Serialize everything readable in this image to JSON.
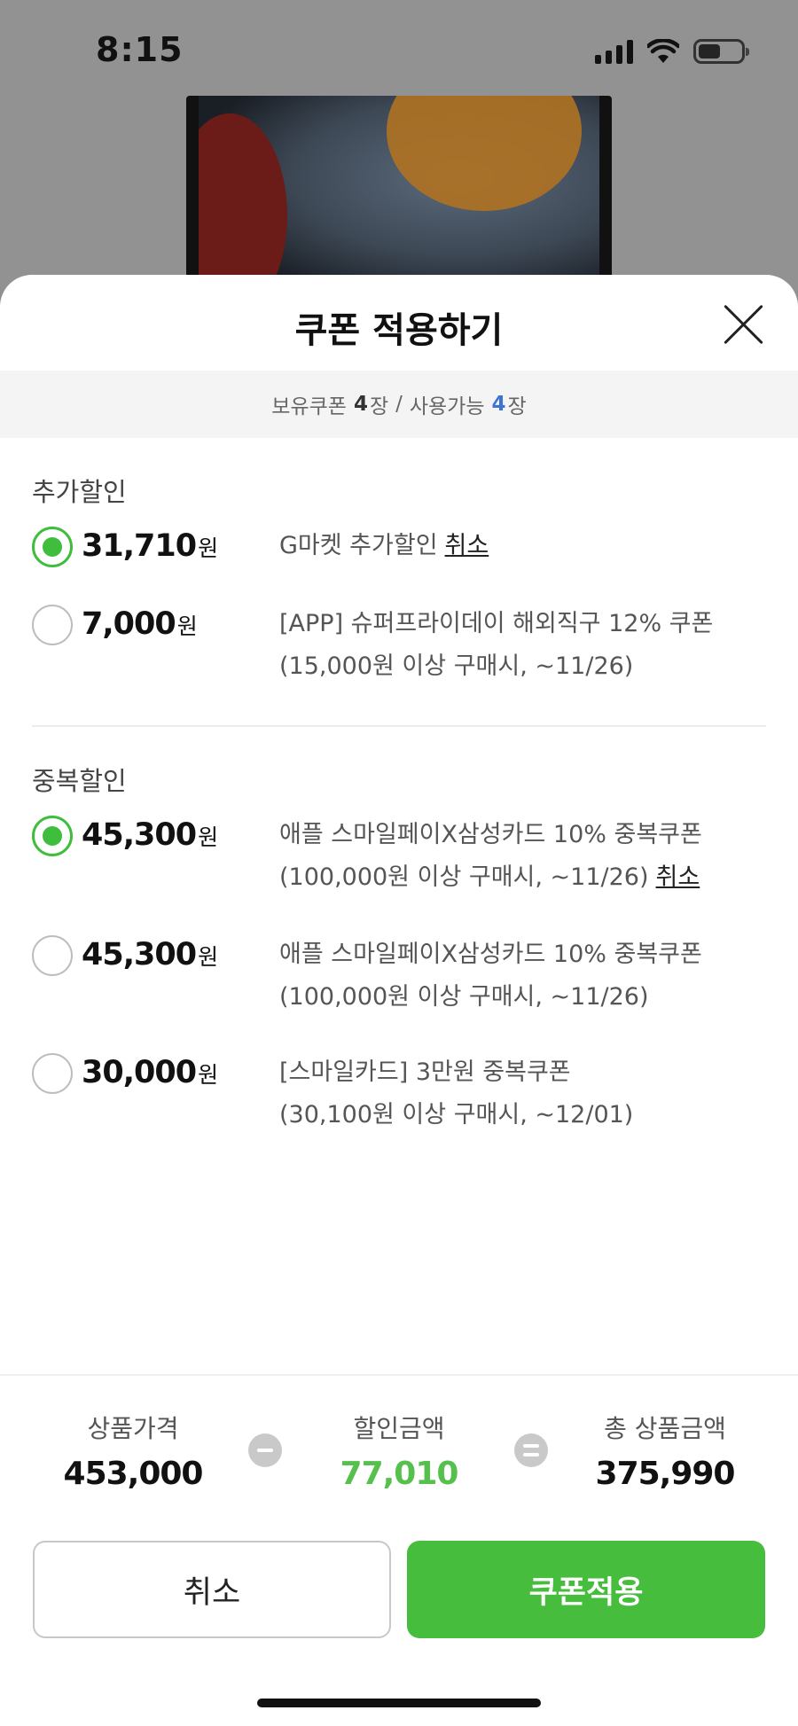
{
  "status_bar": {
    "time": "8:15"
  },
  "sheet": {
    "title": "쿠폰 적용하기",
    "coupon_count": {
      "owned_label": "보유쿠폰",
      "owned_count": "4",
      "owned_unit": "장",
      "separator": "/",
      "usable_label": "사용가능",
      "usable_count": "4",
      "usable_unit": "장"
    }
  },
  "sections": {
    "extra": {
      "title": "추가할인",
      "items": [
        {
          "amount": "31,710",
          "unit": "원",
          "checked": true,
          "line1": "G마켓 추가할인",
          "line2": "",
          "cancel": "취소"
        },
        {
          "amount": "7,000",
          "unit": "원",
          "checked": false,
          "line1": "[APP] 슈퍼프라이데이 해외직구 12% 쿠폰",
          "line2": "(15,000원 이상 구매시, ~11/26)",
          "cancel": ""
        }
      ]
    },
    "duplicate": {
      "title": "중복할인",
      "items": [
        {
          "amount": "45,300",
          "unit": "원",
          "checked": true,
          "line1": "애플 스마일페이X삼성카드 10% 중복쿠폰",
          "line2": "(100,000원 이상 구매시, ~11/26)",
          "cancel": "취소"
        },
        {
          "amount": "45,300",
          "unit": "원",
          "checked": false,
          "line1": "애플 스마일페이X삼성카드 10% 중복쿠폰",
          "line2": "(100,000원 이상 구매시, ~11/26)",
          "cancel": ""
        },
        {
          "amount": "30,000",
          "unit": "원",
          "checked": false,
          "line1": "[스마일카드] 3만원 중복쿠폰",
          "line2": "(30,100원 이상 구매시, ~12/01)",
          "cancel": ""
        }
      ]
    }
  },
  "summary": {
    "price_label": "상품가격",
    "price_value": "453,000",
    "discount_label": "할인금액",
    "discount_value": "77,010",
    "total_label": "총 상품금액",
    "total_value": "375,990"
  },
  "buttons": {
    "cancel": "취소",
    "apply": "쿠폰적용"
  },
  "colors": {
    "accent_green": "#46bd3d",
    "discount_green": "#55c14c",
    "usable_blue": "#3c74d6"
  }
}
